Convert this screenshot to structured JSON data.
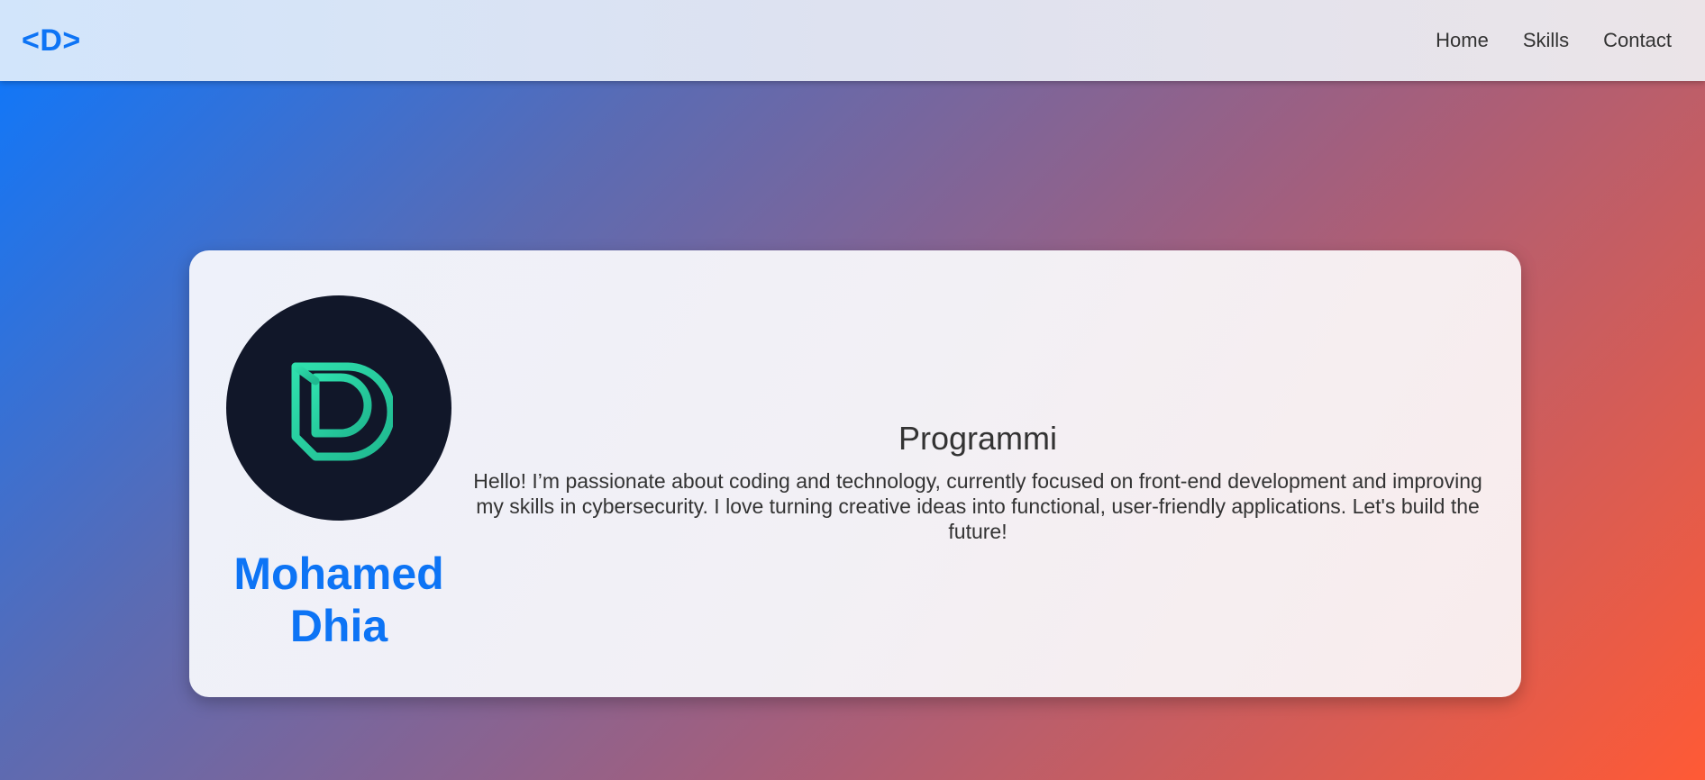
{
  "nav": {
    "brand": "<D>",
    "links": [
      "Home",
      "Skills",
      "Contact"
    ]
  },
  "profile": {
    "avatar_icon": "d-monogram-logo",
    "name_line1": "Mohamed",
    "name_line2": "Dhia",
    "role": "Programmi",
    "bio": "Hello! I’m passionate about coding and technology, currently focused on front-end development and improving my skills in cybersecurity. I love turning creative ideas into functional, user-friendly applications. Let's build the future!"
  },
  "colors": {
    "accent": "#0d74f5",
    "logo_green": "#2dd4a4",
    "avatar_bg": "#111729"
  }
}
